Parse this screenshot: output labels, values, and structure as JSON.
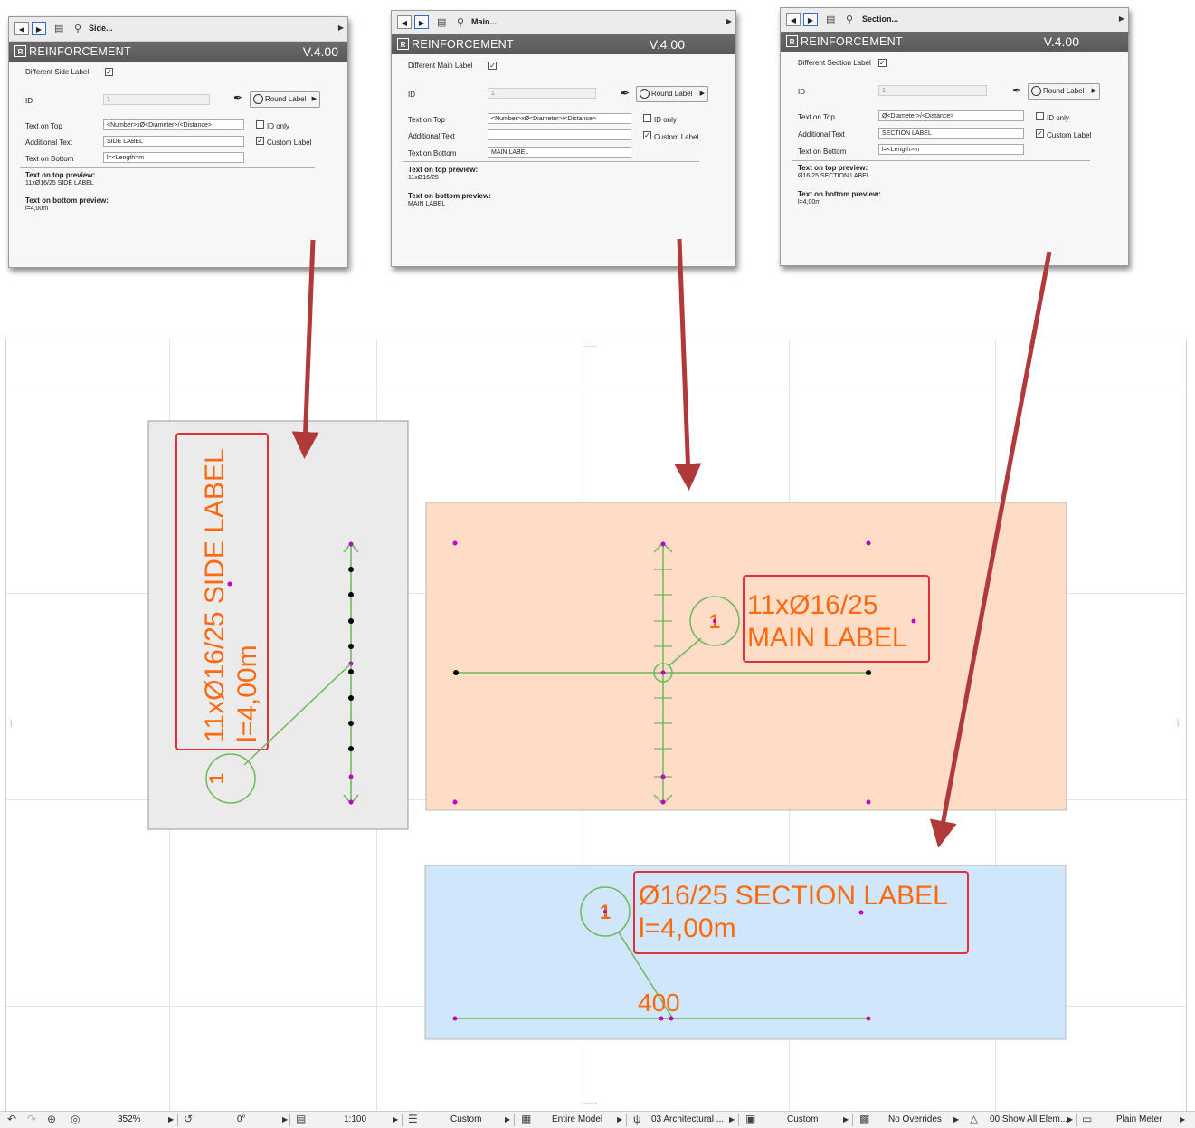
{
  "panels": [
    {
      "toolbar_title": "Side...",
      "header_title": "REINFORCEMENT",
      "version": "V.4.00",
      "diff_label": "Different Side Label",
      "id_label": "ID",
      "id_value": "1",
      "round_label": "Round Label",
      "text_on_top_label": "Text on Top",
      "text_on_top_value": "<Number>xØ<Diameter>/<Distance>",
      "additional_text_label": "Additional Text",
      "additional_text_value": "SIDE LABEL",
      "text_on_bottom_label": "Text on Bottom",
      "text_on_bottom_value": "l=<Length>m",
      "id_only_label": "ID only",
      "custom_label": "Custom Label",
      "top_preview_label": "Text on top preview:",
      "top_preview_value": "11xØ16/25 SIDE LABEL",
      "bottom_preview_label": "Text on bottom preview:",
      "bottom_preview_value": "l=4,00m"
    },
    {
      "toolbar_title": "Main...",
      "header_title": "REINFORCEMENT",
      "version": "V.4.00",
      "diff_label": "Different Main Label",
      "id_label": "ID",
      "id_value": "1",
      "round_label": "Round Label",
      "text_on_top_label": "Text on Top",
      "text_on_top_value": "<Number>xØ<Diameter>/<Distance>",
      "additional_text_label": "Additional Text",
      "additional_text_value": "",
      "text_on_bottom_label": "Text on Bottom",
      "text_on_bottom_value": "MAIN LABEL",
      "id_only_label": "ID only",
      "custom_label": "Custom Label",
      "top_preview_label": "Text on top preview:",
      "top_preview_value": "11xØ16/25",
      "bottom_preview_label": "Text on bottom preview:",
      "bottom_preview_value": "MAIN LABEL"
    },
    {
      "toolbar_title": "Section...",
      "header_title": "REINFORCEMENT",
      "version": "V.4.00",
      "diff_label": "Different Section Label",
      "id_label": "ID",
      "id_value": "1",
      "round_label": "Round Label",
      "text_on_top_label": "Text on Top",
      "text_on_top_value": "Ø<Diameter>/<Distance>",
      "additional_text_label": "Additional Text",
      "additional_text_value": "SECTION LABEL",
      "text_on_bottom_label": "Text on Bottom",
      "text_on_bottom_value": "l=<Length>m",
      "id_only_label": "ID only",
      "custom_label": "Custom Label",
      "top_preview_label": "Text on top preview:",
      "top_preview_value": "Ø16/25 SECTION LABEL",
      "bottom_preview_label": "Text on bottom preview:",
      "bottom_preview_value": "l=4,00m"
    }
  ],
  "drawing": {
    "side": {
      "line1": "11xØ16/25 SIDE LABEL",
      "line2": "l=4,00m",
      "marker": "1"
    },
    "main": {
      "line1": "11xØ16/25",
      "line2": "MAIN LABEL",
      "marker": "1"
    },
    "section": {
      "line1": "Ø16/25 SECTION LABEL",
      "line2": "l=4,00m",
      "marker": "1",
      "dimension": "400"
    }
  },
  "colors": {
    "label_text": "#ff6a10",
    "label_frame": "#e0303a",
    "arrow": "#b03a3a",
    "rebar_line": "#6db85a",
    "node_magenta": "#c000c0",
    "side_fill": "#ebebeb",
    "main_fill": "#ffdcc5",
    "section_fill": "#d0e6fa"
  },
  "statusbar": {
    "zoom": "352%",
    "angle": "0°",
    "scale": "1:100",
    "layer_combo": "Custom",
    "model_filter": "Entire Model",
    "structure": "03 Architectural ...",
    "pen_set": "Custom",
    "overrides": "No Overrides",
    "renovation": "00 Show All Elem...",
    "dimension": "Plain Meter"
  },
  "icons": {
    "back": "back-triangle-icon",
    "forward": "forward-triangle-icon",
    "settings": "favorites-icon",
    "search": "magnifier-icon",
    "pen": "pen-icon",
    "undo": "undo-icon",
    "redo": "redo-icon",
    "zoom_in": "zoom-in-icon",
    "fit": "fit-in-window-icon"
  }
}
